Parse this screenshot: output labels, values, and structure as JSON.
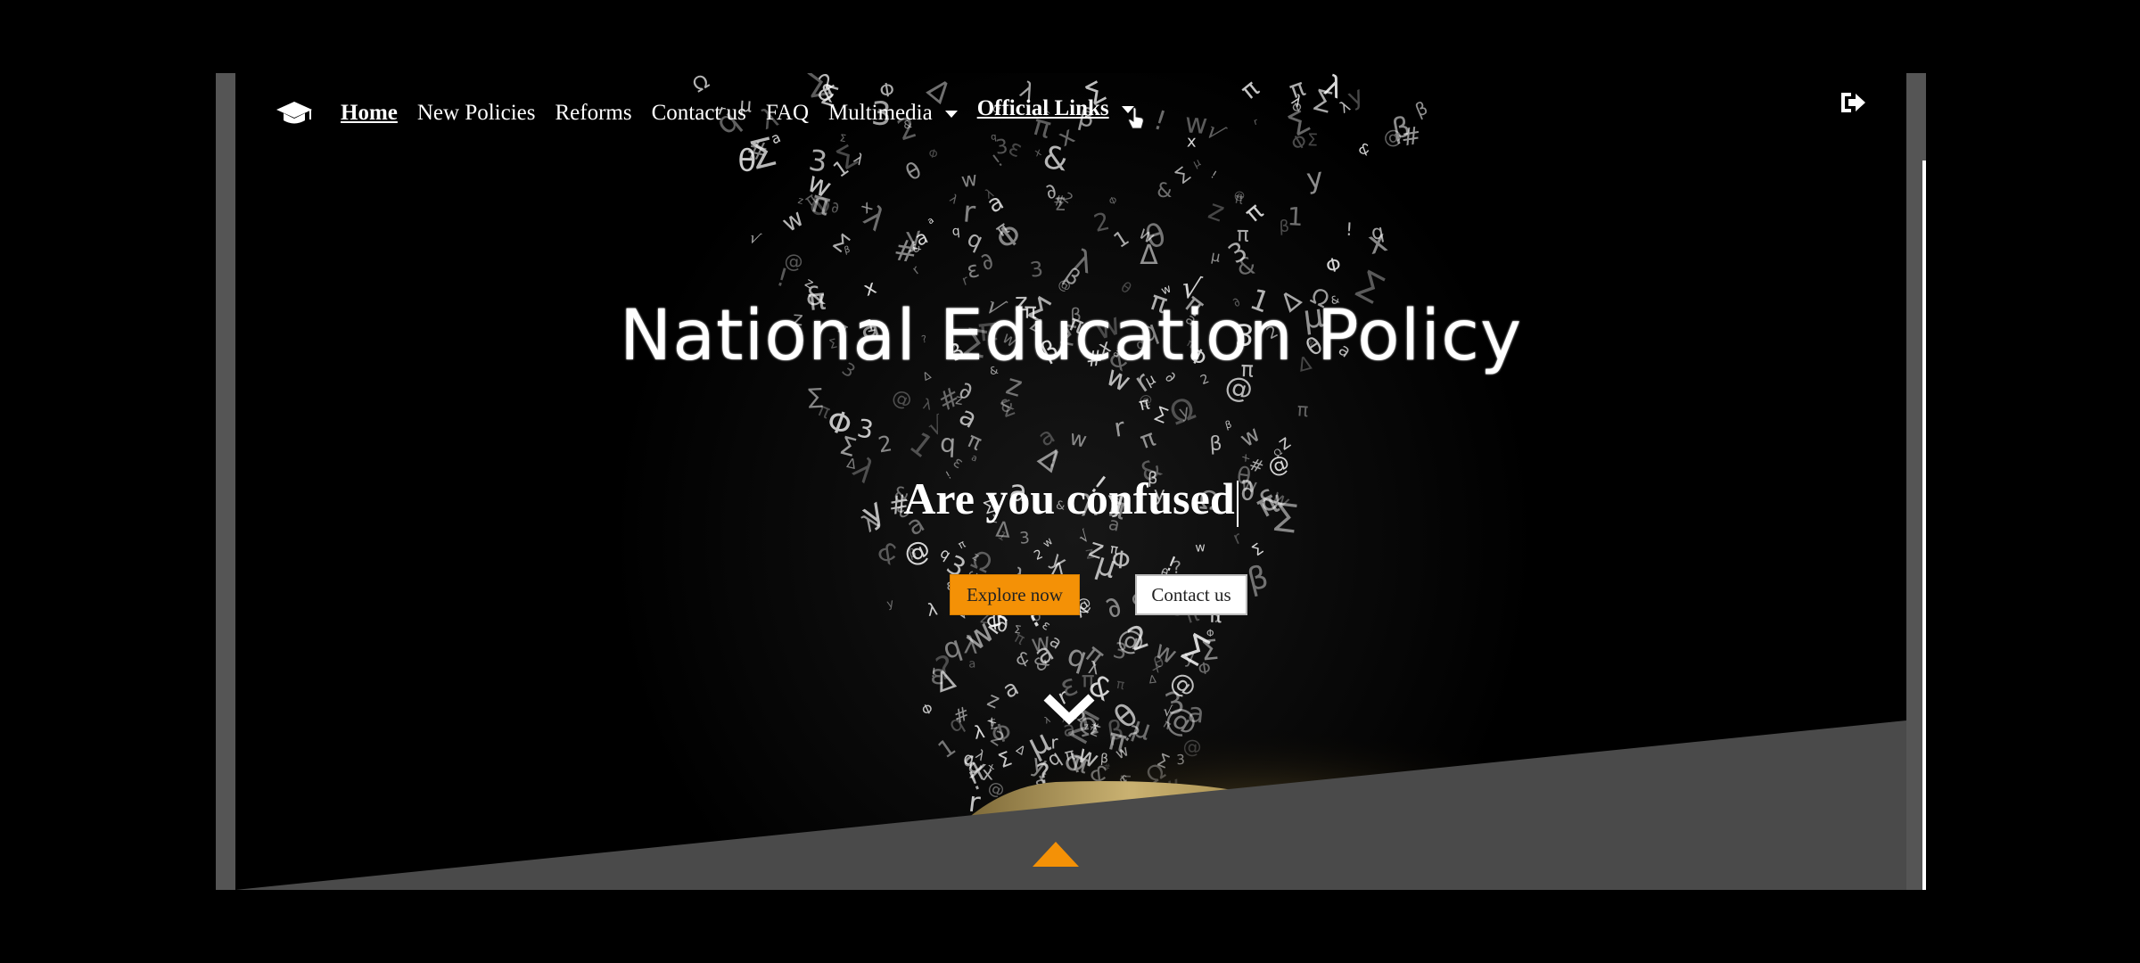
{
  "nav": {
    "logo_icon": "graduation-cap-icon",
    "items": [
      {
        "label": "Home",
        "state": "active"
      },
      {
        "label": "New Policies"
      },
      {
        "label": "Reforms"
      },
      {
        "label": "Contact us"
      },
      {
        "label": "FAQ"
      },
      {
        "label": "Multimedia",
        "dropdown": true
      },
      {
        "label": "Official Links",
        "dropdown": true,
        "state": "hovered"
      }
    ],
    "logout_icon": "sign-out-icon"
  },
  "hero": {
    "title": "National Education Policy",
    "subtitle": "Are you confused",
    "explore_label": "Explore now",
    "contact_label": "Contact us",
    "scroll_down_icon": "chevron-down-icon",
    "scroll_up_icon": "triangle-up-icon",
    "accent_color": "#f49106",
    "slant_color": "#4a4a4a"
  }
}
